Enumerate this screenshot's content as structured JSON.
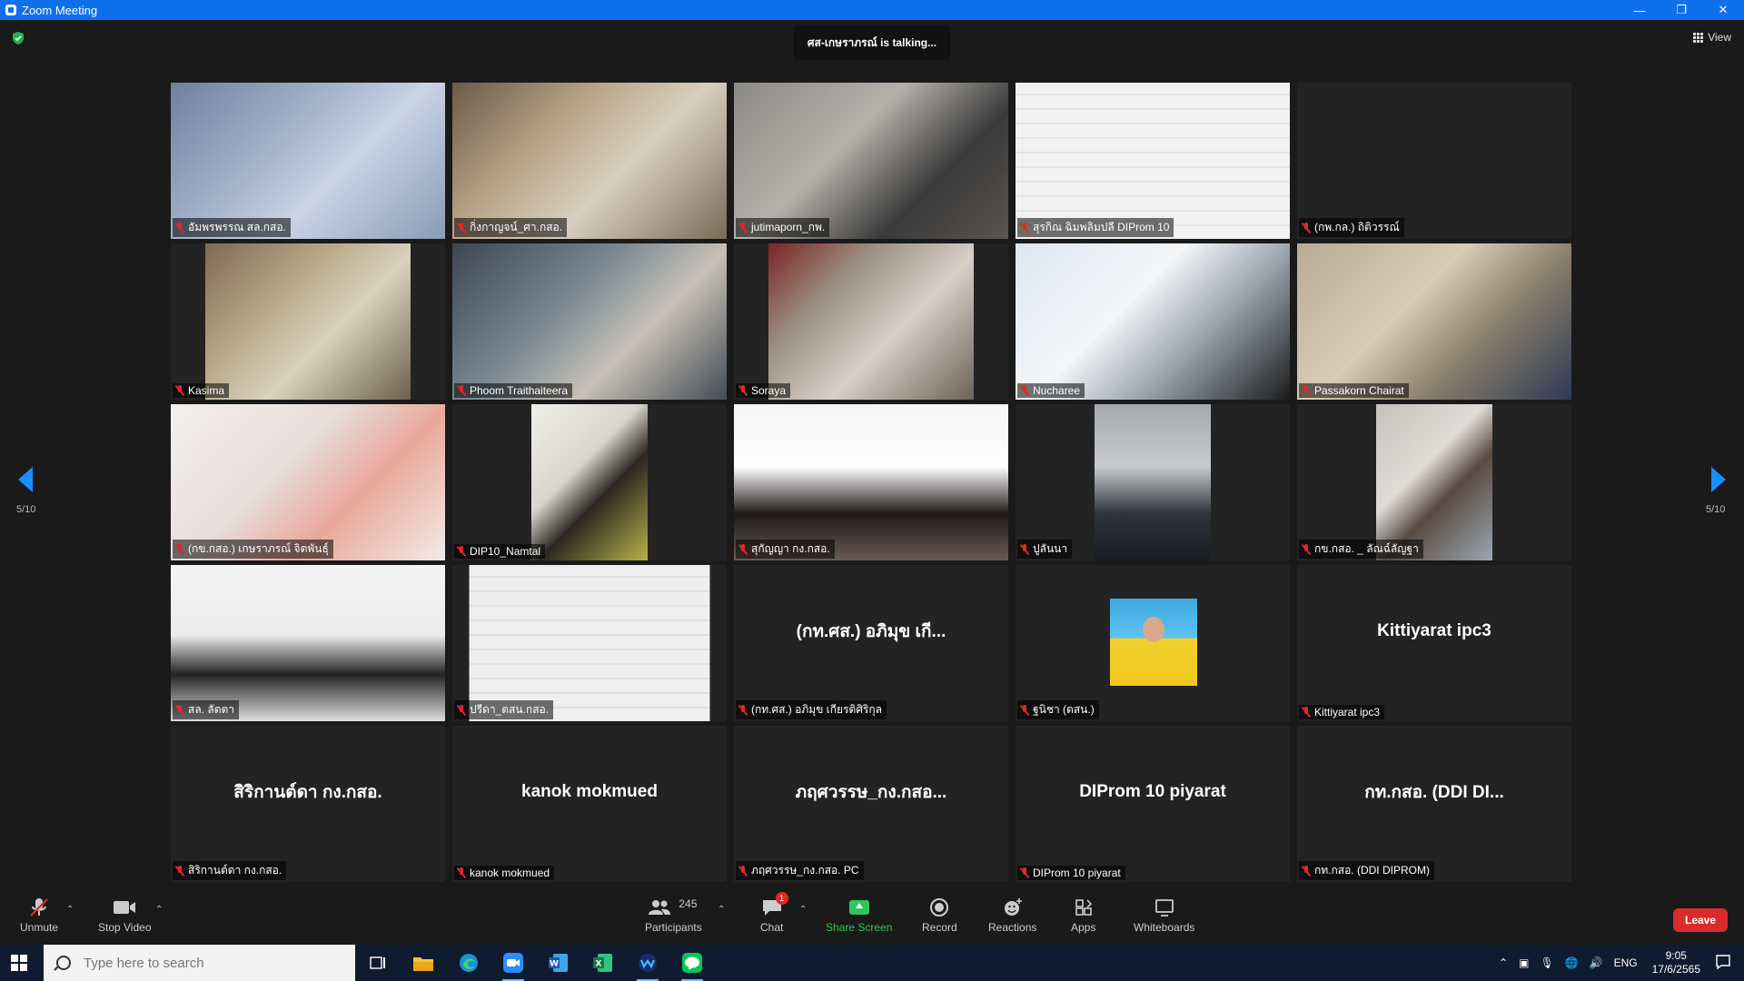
{
  "window": {
    "title": "Zoom Meeting",
    "controls": [
      "—",
      "❐",
      "✕"
    ]
  },
  "meeting": {
    "talking": "ศส-เกษราภรณ์ is talking...",
    "view_label": "View",
    "page_indicator": "5/10"
  },
  "participants": [
    {
      "name": "อัมพรพรรณ สล.กสอ.",
      "kind": "video",
      "bg": "linear-gradient(135deg,#6f7fa0 0%,#a6b4cc 40%,#c9d4e4 60%,#8a9bb8 100%)",
      "w": 302
    },
    {
      "name": "กิ่งกาญจน์_ศา.กสอ.",
      "kind": "video",
      "bg": "linear-gradient(135deg,#6a5a48 0%,#b9a688 35%,#d9cfc0 60%,#7a6a58 100%)",
      "w": 302
    },
    {
      "name": "jutimaporn_กพ.",
      "kind": "video",
      "bg": "linear-gradient(135deg,#8c8a86 0%,#b4b0aa 40%,#3a3a3a 70%,#5a5550 100%)",
      "w": 302
    },
    {
      "name": "สุรกิณ ฉิมพลิมปลี DIProm 10",
      "kind": "video",
      "bg": "repeating-linear-gradient(0deg,#f2f2f2 0px,#f2f2f2 14px,#d8d8d8 15px,#f2f2f2 16px)",
      "w": 302
    },
    {
      "name": "(กพ.กล.) ถิติวรรณ์",
      "kind": "none",
      "bigname": "",
      "w": 302
    },
    {
      "name": "Kasima",
      "kind": "video",
      "bg": "linear-gradient(135deg,#7c6a52 0%,#b7a787 35%,#dad2bd 60%,#6b604c 100%)",
      "w": 226
    },
    {
      "name": "Phoom Traithaiteera",
      "kind": "video",
      "bg": "linear-gradient(135deg,#3b4652 0%,#7a8894 40%,#c7c1b6 65%,#434b54 100%)",
      "w": 302
    },
    {
      "name": "Soraya",
      "kind": "video",
      "bg": "linear-gradient(135deg,#7a2424 0%,#9b8f82 30%,#d6d0c6 60%,#6e6256 100%)",
      "w": 226
    },
    {
      "name": "Nucharee",
      "kind": "video",
      "bg": "linear-gradient(135deg,#dfe7f0 0%,#f4f6f8 40%,#9aa4ad 65%,#1c1c1c 100%)",
      "w": 302
    },
    {
      "name": "Passakorn Chairat",
      "kind": "video",
      "bg": "linear-gradient(135deg,#b8aa95 0%,#d8ccb8 40%,#8a7e6c 65%,#2e3a55 100%)",
      "w": 302
    },
    {
      "name": "(กข.กสอ.) เกษราภรณ์ จิตพันธ์ุ",
      "kind": "video",
      "bg": "linear-gradient(135deg,#f3f0ee 0%,#e8dedb 40%,#e9a89a 65%,#f2ebe7 100%)",
      "w": 302
    },
    {
      "name": "DIP10_Namtal",
      "kind": "video",
      "bg": "linear-gradient(135deg,#efefe9 0%,#d9d6cc 40%,#2b2622 60%,#b8b24a 100%)",
      "w": 128
    },
    {
      "name": "สุกัญญา กง.กสอ.",
      "kind": "video",
      "bg": "linear-gradient(180deg,#f5f5f5 0%,#ffffff 40%,#1e1a18 70%,#6b5a52 100%)",
      "w": 302
    },
    {
      "name": "ปูลันนา",
      "kind": "video",
      "bg": "linear-gradient(180deg,#a5a9ad 0%,#c8cbcd 40%,#2f343a 70%,#1a1d22 100%)",
      "w": 128
    },
    {
      "name": "กข.กสอ. _ ลัณฉ์ลัญฐา",
      "kind": "video",
      "bg": "linear-gradient(135deg,#c6c3be 0%,#e0ddd8 40%,#5a4a40 60%,#9aa6b4 100%)",
      "w": 128
    },
    {
      "name": "สล. ลัตตา",
      "kind": "video",
      "bg": "linear-gradient(180deg,#f4f4f4 0%,#ebebeb 45%,#232323 70%,#dedede 100%)",
      "w": 302
    },
    {
      "name": "ปรีดา_ตสน.กสอ.",
      "kind": "video",
      "bg": "repeating-linear-gradient(0deg,#eeeeee 0px,#eeeeee 14px,#d4d4d4 15px,#eeeeee 16px)",
      "w": 265
    },
    {
      "name": "(กท.ศส.) อภิมุข เกียรติศิริกุล",
      "kind": "none",
      "bigname": "(กท.ศส.) อภิมุข เกี...",
      "w": 302
    },
    {
      "name": "ฐนิชา (ตสน.)",
      "kind": "avatar",
      "bigname": "",
      "w": 302
    },
    {
      "name": "Kittiyarat ipc3",
      "kind": "none",
      "bigname": "Kittiyarat ipc3",
      "w": 302
    },
    {
      "name": "สิริกานต์ดา กง.กสอ.",
      "kind": "none",
      "bigname": "สิริกานต์ดา กง.กสอ.",
      "w": 302
    },
    {
      "name": "kanok mokmued",
      "kind": "none",
      "bigname": "kanok mokmued",
      "w": 302
    },
    {
      "name": "ภฤศวรรษ_กง.กสอ. PC",
      "kind": "none",
      "bigname": "ภฤศวรรษ_กง.กสอ...",
      "w": 302
    },
    {
      "name": "DIProm 10 piyarat",
      "kind": "none",
      "bigname": "DIProm 10 piyarat",
      "w": 302
    },
    {
      "name": "กท.กสอ. (DDI DIPROM)",
      "kind": "none",
      "bigname": "กท.กสอ. (DDI DI...",
      "w": 302
    }
  ],
  "toolbar": {
    "unmute": "Unmute",
    "stop_video": "Stop Video",
    "participants": "Participants",
    "participant_count": "245",
    "chat": "Chat",
    "chat_badge": "1",
    "share_screen": "Share Screen",
    "record": "Record",
    "reactions": "Reactions",
    "apps": "Apps",
    "whiteboards": "Whiteboards",
    "leave": "Leave"
  },
  "taskbar": {
    "search_placeholder": "Type here to search",
    "language": "ENG",
    "time": "9:05",
    "date": "17/6/2565"
  },
  "colors": {
    "zoom_blue": "#0e71eb",
    "share_green": "#2ec85a",
    "leave_red": "#d92b2b",
    "mute_red": "#e02828"
  }
}
